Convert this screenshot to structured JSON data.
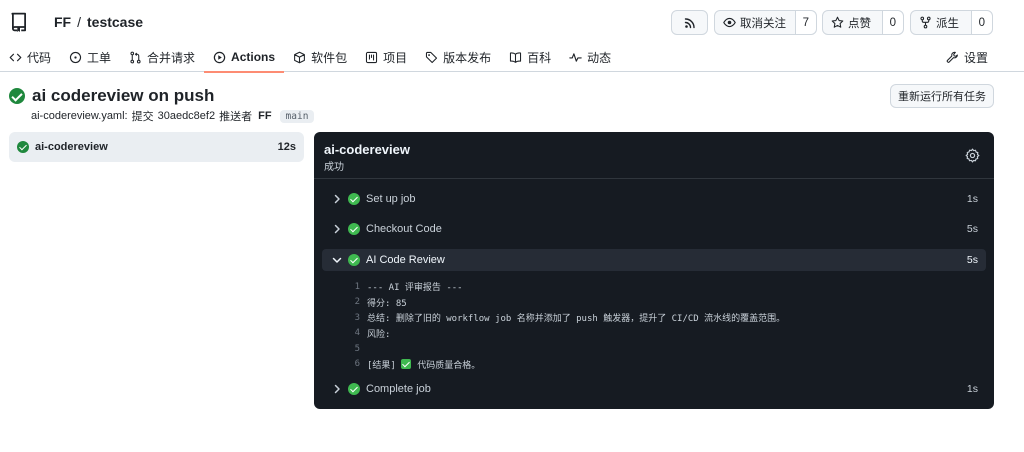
{
  "repo": {
    "owner": "FF",
    "separator": "/",
    "name": "testcase"
  },
  "header_buttons": {
    "rss_icon": "rss-icon",
    "watch": {
      "label": "取消关注",
      "count": "7",
      "icon": "eye-icon"
    },
    "star": {
      "label": "点赞",
      "count": "0",
      "icon": "star-icon"
    },
    "fork": {
      "label": "派生",
      "count": "0",
      "icon": "fork-icon"
    }
  },
  "tabs": [
    {
      "label": "代码",
      "icon": "code-icon"
    },
    {
      "label": "工单",
      "icon": "issue-icon"
    },
    {
      "label": "合并请求",
      "icon": "pull-request-icon"
    },
    {
      "label": "Actions",
      "icon": "play-icon",
      "active": true
    },
    {
      "label": "软件包",
      "icon": "package-icon"
    },
    {
      "label": "项目",
      "icon": "project-icon"
    },
    {
      "label": "版本发布",
      "icon": "tag-icon"
    },
    {
      "label": "百科",
      "icon": "book-icon"
    },
    {
      "label": "动态",
      "icon": "pulse-icon"
    }
  ],
  "settings_tab": {
    "label": "设置",
    "icon": "tools-icon"
  },
  "run": {
    "title": "ai codereview on push",
    "workflow_file": "ai-codereview.yaml:",
    "commit_text": "提交",
    "commit_sha": "30aedc8ef2",
    "pushed_by_text": "推送者",
    "actor": "FF",
    "branch": "main",
    "rerun_label": "重新运行所有任务",
    "status_color": "#1f883d"
  },
  "sidebar": {
    "job_name": "ai-codereview",
    "job_duration": "12s"
  },
  "log": {
    "job_name": "ai-codereview",
    "job_status": "成功",
    "steps": [
      {
        "name": "Set up job",
        "duration": "1s"
      },
      {
        "name": "Checkout Code",
        "duration": "5s"
      },
      {
        "name": "AI Code Review",
        "duration": "5s",
        "expanded": true
      },
      {
        "name": "Complete job",
        "duration": "1s"
      }
    ],
    "lines": [
      {
        "n": "1",
        "text": "--- AI 评审报告 ---"
      },
      {
        "n": "2",
        "text": "得分: 85"
      },
      {
        "n": "3",
        "text": "总结: 删除了旧的 workflow job 名称并添加了 push 触发器，提升了 CI/CD 流水线的覆盖范围。"
      },
      {
        "n": "4",
        "text": "风险:"
      },
      {
        "n": "5",
        "text": ""
      },
      {
        "n": "6",
        "prefix": "[结果]",
        "text": "代码质量合格。"
      }
    ]
  }
}
